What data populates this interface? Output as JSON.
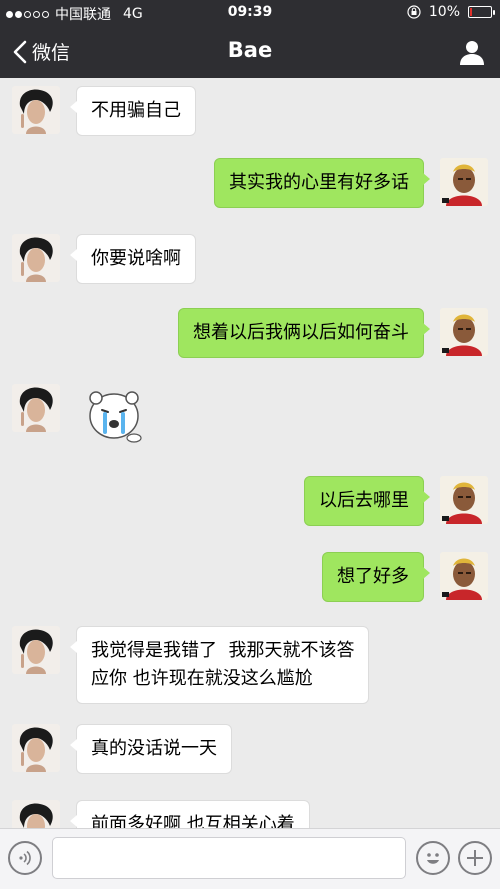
{
  "status_bar": {
    "carrier": "中国联通",
    "network": "4G",
    "time": "09:39",
    "battery": "10%",
    "battery_level": 0.1,
    "signal_bars": 2,
    "signal_total": 5
  },
  "nav": {
    "back_label": "微信",
    "title": "Bae"
  },
  "messages": [
    {
      "side": "in",
      "text": "不用骗自己"
    },
    {
      "side": "out",
      "text": "其实我的心里有好多话"
    },
    {
      "side": "in",
      "text": "你要说啥啊"
    },
    {
      "side": "out",
      "text": "想着以后我俩以后如何奋斗"
    },
    {
      "side": "in",
      "sticker": "crying-bear-sticker"
    },
    {
      "side": "out",
      "text": "以后去哪里"
    },
    {
      "side": "out",
      "text": "想了好多"
    },
    {
      "side": "in",
      "text": "我觉得是我错了  我那天就不该答\n应你 也许现在就没这么尴尬"
    },
    {
      "side": "in",
      "text": "真的没话说一天"
    },
    {
      "side": "in",
      "text": "前面多好啊 也互相关心着"
    }
  ],
  "input": {
    "placeholder": "",
    "voice_icon": "voice-icon",
    "emoji_icon": "emoji-icon",
    "plus_icon": "plus-icon"
  },
  "colors": {
    "bar": "#2e2e32",
    "bubble_out": "#9fe65f",
    "bubble_in": "#ffffff",
    "background": "#ebebeb"
  }
}
